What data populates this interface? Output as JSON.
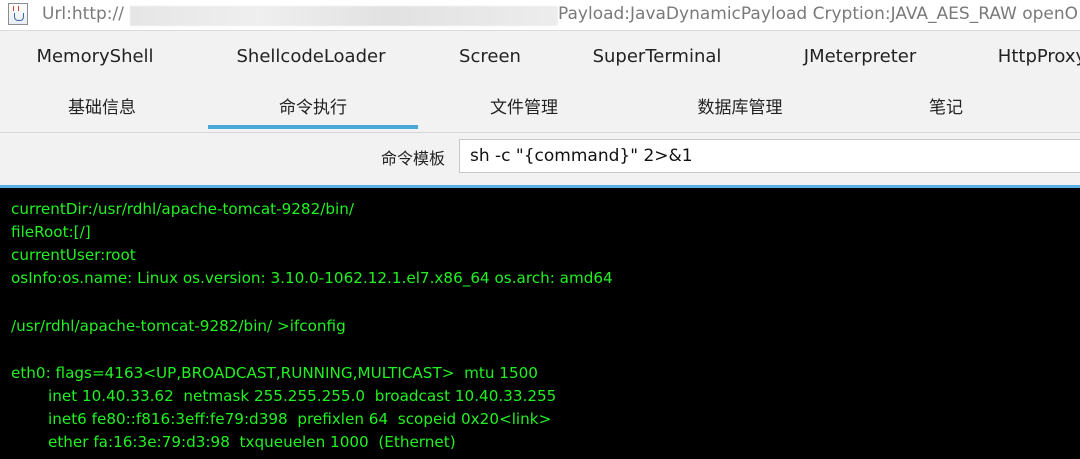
{
  "window": {
    "url_prefix": "Url:http://",
    "payload_info": "Payload:JavaDynamicPayload Cryption:JAVA_AES_RAW openO"
  },
  "toolbar": {
    "items": [
      "MemoryShell",
      "ShellcodeLoader",
      "Screen",
      "SuperTerminal",
      "JMeterpreter",
      "HttpProxy"
    ]
  },
  "tabs": {
    "items": [
      "基础信息",
      "命令执行",
      "文件管理",
      "数据库管理",
      "笔记"
    ],
    "active": "命令执行"
  },
  "command": {
    "template_label": "命令模板",
    "template_value": "sh -c \"{command}\" 2>&1"
  },
  "terminal": {
    "text_color": "#22f022",
    "background": "#000000",
    "lines": [
      "currentDir:/usr/rdhl/apache-tomcat-9282/bin/",
      "fileRoot:[/]",
      "currentUser:root",
      "osInfo:os.name: Linux os.version: 3.10.0-1062.12.1.el7.x86_64 os.arch: amd64",
      "/usr/rdhl/apache-tomcat-9282/bin/ >ifconfig",
      "eth0: flags=4163<UP,BROADCAST,RUNNING,MULTICAST>  mtu 1500",
      "inet 10.40.33.62  netmask 255.255.255.0  broadcast 10.40.33.255",
      "inet6 fe80::f816:3eff:fe79:d398  prefixlen 64  scopeid 0x20<link>",
      "ether fa:16:3e:79:d3:98  txqueuelen 1000  (Ethernet)"
    ]
  }
}
